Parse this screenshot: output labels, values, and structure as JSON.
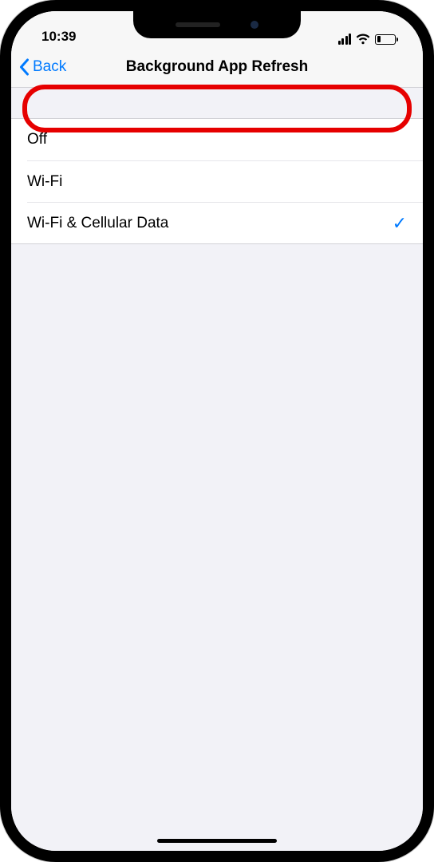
{
  "status": {
    "time": "10:39"
  },
  "nav": {
    "back_label": "Back",
    "title": "Background App Refresh"
  },
  "options": [
    {
      "label": "Off",
      "selected": false,
      "highlighted": true
    },
    {
      "label": "Wi-Fi",
      "selected": false,
      "highlighted": false
    },
    {
      "label": "Wi-Fi & Cellular Data",
      "selected": true,
      "highlighted": false
    }
  ],
  "colors": {
    "ios_blue": "#007aff",
    "highlight_red": "#e60000",
    "background": "#f2f2f7"
  }
}
